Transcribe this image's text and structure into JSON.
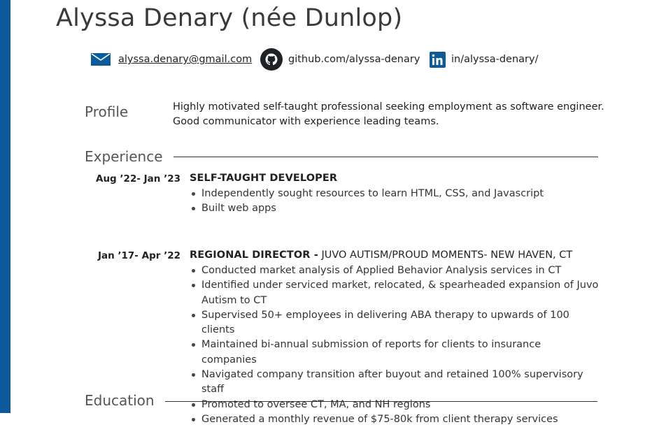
{
  "header": {
    "name": "Alyssa Denary (née Dunlop)"
  },
  "contact": {
    "email": "alyssa.denary@gmail.com",
    "github": "github.com/alyssa-denary",
    "linkedin": "in/alyssa-denary/"
  },
  "profile": {
    "label": "Profile",
    "text": "Highly motivated self-taught professional seeking employment as software engineer. Good communicator with experience leading teams."
  },
  "experience": {
    "label": "Experience",
    "jobs": [
      {
        "dates": "Aug ’22- Jan ’23",
        "role": "SELF-TAUGHT DEVELOPER",
        "org": "",
        "bullets": [
          "Independently sought resources to learn HTML, CSS, and Javascript",
          "Built web apps"
        ]
      },
      {
        "dates": "Jan ’17- Apr ’22",
        "role": "REGIONAL DIRECTOR -",
        "org": " JUVO AUTISM/PROUD MOMENTS- NEW HAVEN, CT",
        "bullets": [
          "Conducted market analysis of Applied Behavior Analysis services in CT",
          "Identified under serviced market, relocated, & spearheaded expansion of Juvo Autism to CT",
          "Supervised 50+ employees in delivering ABA therapy to upwards of 100 clients",
          "Maintained bi-annual submission of reports for clients to insurance companies",
          "Navigated company transition after buyout and retained 100% supervisory staff",
          "Promoted to oversee CT, MA, and NH regions",
          "Generated a monthly revenue of $75-80k from client therapy services"
        ]
      }
    ]
  },
  "education": {
    "label": "Education"
  },
  "colors": {
    "accent_bar": "#0b5a9c",
    "icon_blue": "#0b5a9c",
    "github_icon": "#1f2328"
  },
  "icons": {
    "email": "envelope-icon",
    "github": "github-icon",
    "linkedin": "linkedin-icon"
  }
}
